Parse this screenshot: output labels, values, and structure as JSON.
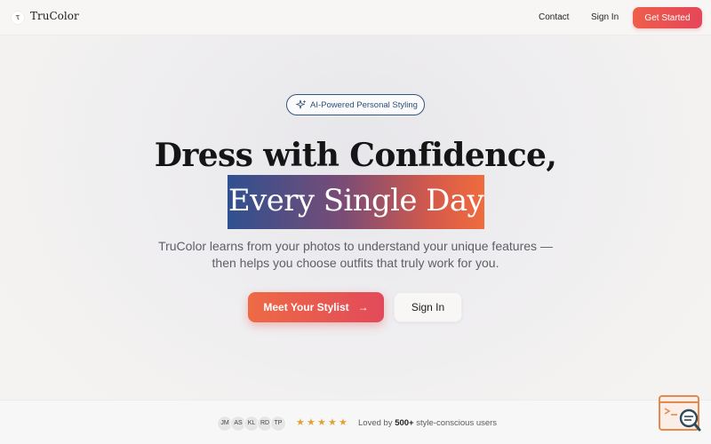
{
  "header": {
    "logo_mark": "τ",
    "logo_text": "TruColor",
    "nav": {
      "contact": "Contact",
      "sign_in": "Sign In"
    },
    "cta": "Get Started"
  },
  "hero": {
    "badge": "AI-Powered Personal Styling",
    "headline_line1": "Dress with Confidence,",
    "headline_line2": "Every Single Day",
    "subtitle": "TruColor learns from your photos to understand your unique features — then helps you choose outfits that truly work for you.",
    "primary_button": "Meet Your Stylist",
    "primary_arrow": "→",
    "secondary_button": "Sign In"
  },
  "social_proof": {
    "avatars": [
      "JM",
      "AS",
      "KL",
      "RD",
      "TP"
    ],
    "rating_stars": 5,
    "loved_prefix": "Loved by ",
    "loved_count": "500+",
    "loved_suffix": " style-conscious users"
  },
  "colors": {
    "accent": "#e9544f",
    "navy": "#2f4f78",
    "star": "#e0a23a"
  },
  "icons": {
    "badge": "sparkle-icon",
    "widget": "search-chat-icon"
  }
}
